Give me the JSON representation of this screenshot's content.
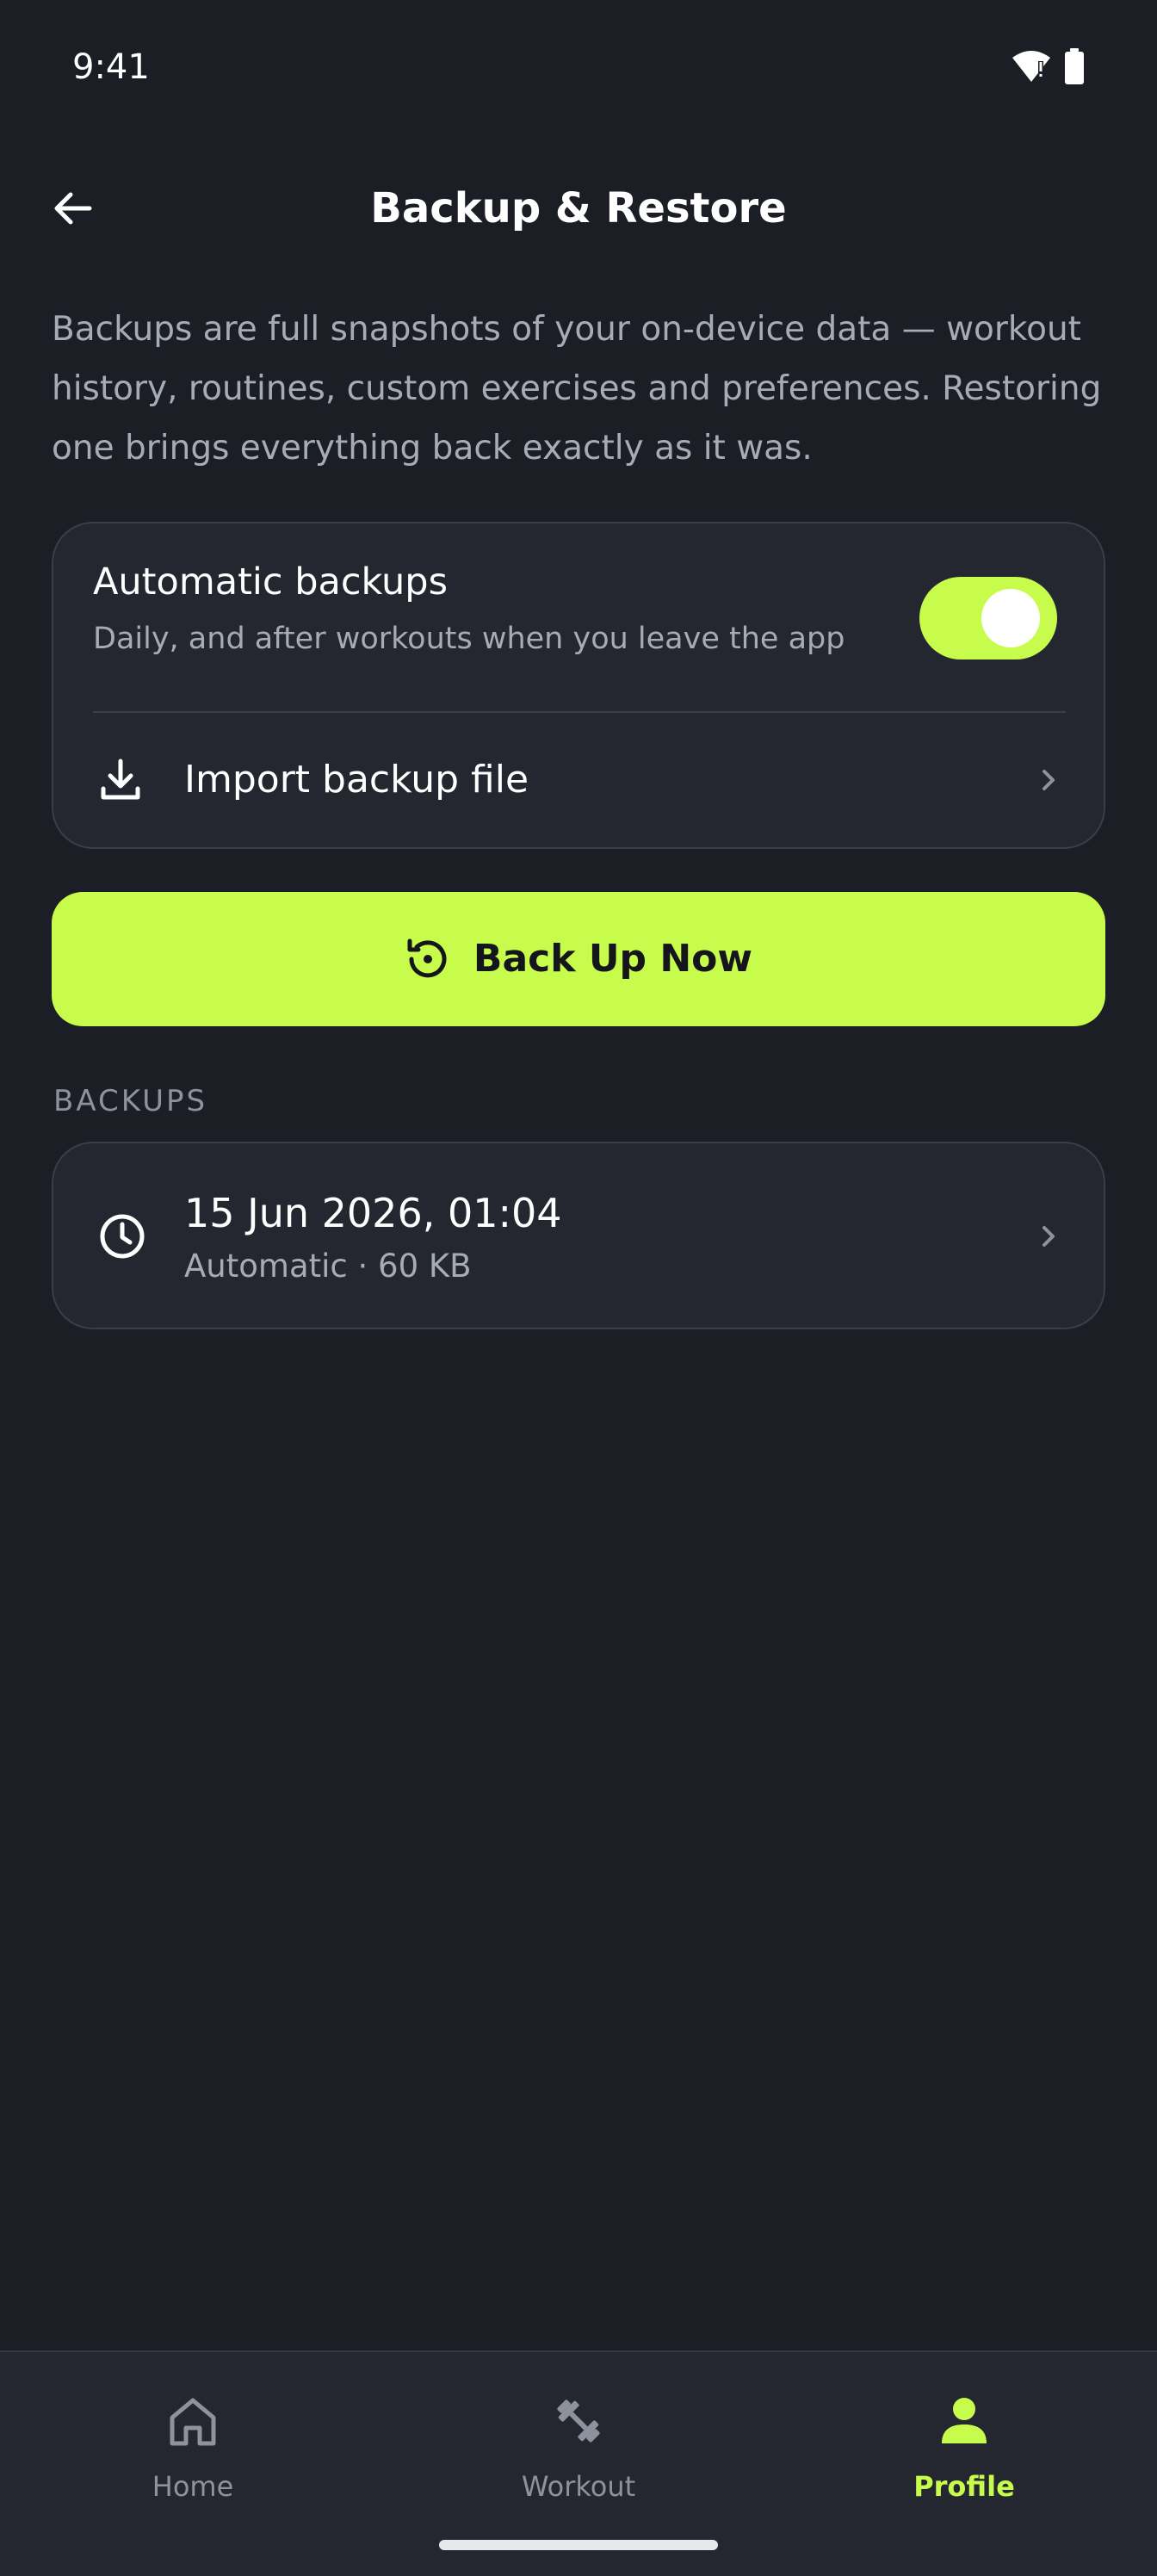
{
  "status_bar": {
    "time": "9:41",
    "icons": [
      "wifi-alert-icon",
      "battery-icon"
    ]
  },
  "header": {
    "back_icon": "arrow-left-icon",
    "title": "Backup & Restore"
  },
  "description": "Backups are full snapshots of your on-device data — workout history, routines, custom exercises and preferences. Restoring one brings everything back exactly as it was.",
  "settings_card": {
    "auto_backups": {
      "title": "Automatic backups",
      "subtitle": "Daily, and after workouts when you leave the app",
      "enabled": true
    },
    "import": {
      "icon": "download-icon",
      "label": "Import backup file"
    }
  },
  "backup_button": {
    "icon": "restore-clock-icon",
    "label": "Back Up Now"
  },
  "backups_section": {
    "label": "BACKUPS",
    "items": [
      {
        "icon": "clock-icon",
        "date": "15 Jun 2026, 01:04",
        "meta": "Automatic · 60 KB"
      }
    ]
  },
  "bottom_nav": {
    "items": [
      {
        "label": "Home",
        "icon": "home-icon",
        "active": false
      },
      {
        "label": "Workout",
        "icon": "dumbbell-icon",
        "active": false
      },
      {
        "label": "Profile",
        "icon": "person-icon",
        "active": true
      }
    ]
  },
  "colors": {
    "background": "#1b1e25",
    "card": "#242730",
    "accent": "#c8fc4c",
    "text_primary": "#ffffff",
    "text_secondary": "#a7abb5"
  }
}
